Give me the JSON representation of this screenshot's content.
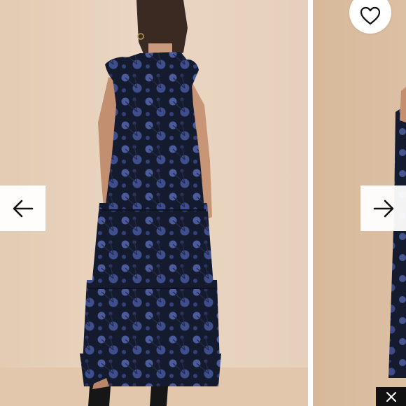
{
  "carousel": {
    "prev_icon": "arrow-left-icon",
    "next_icon": "arrow-right-icon",
    "favorite_icon": "heart-outline-icon",
    "close_icon": "close-icon"
  },
  "colors": {
    "backdrop": "#e6d0bb",
    "dress_base": "#141a2c",
    "lace_flower": "#4a5a98",
    "button_bg": "#ffffff",
    "close_bg": "#111111"
  }
}
